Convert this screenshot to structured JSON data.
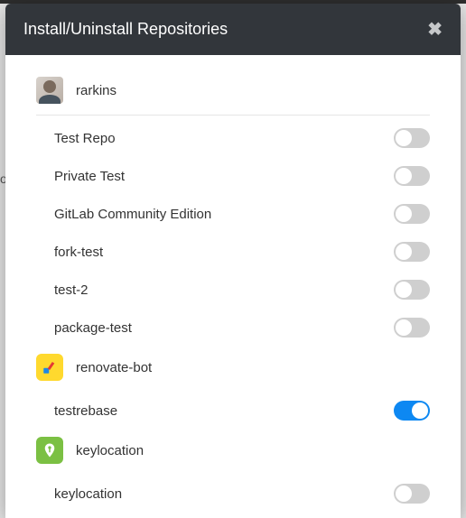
{
  "modal": {
    "title": "Install/Uninstall Repositories"
  },
  "behind_text_fragment": "o",
  "owners": [
    {
      "name": "rarkins",
      "avatar": "rarkins",
      "repos": [
        {
          "name": "Test Repo",
          "enabled": false
        },
        {
          "name": "Private Test",
          "enabled": false
        },
        {
          "name": "GitLab Community Edition",
          "enabled": false
        },
        {
          "name": "fork-test",
          "enabled": false
        },
        {
          "name": "test-2",
          "enabled": false
        },
        {
          "name": "package-test",
          "enabled": false
        }
      ]
    },
    {
      "name": "renovate-bot",
      "avatar": "renovate",
      "repos": [
        {
          "name": "testrebase",
          "enabled": true
        }
      ]
    },
    {
      "name": "keylocation",
      "avatar": "keylocation",
      "repos": [
        {
          "name": "keylocation",
          "enabled": false
        }
      ]
    }
  ]
}
